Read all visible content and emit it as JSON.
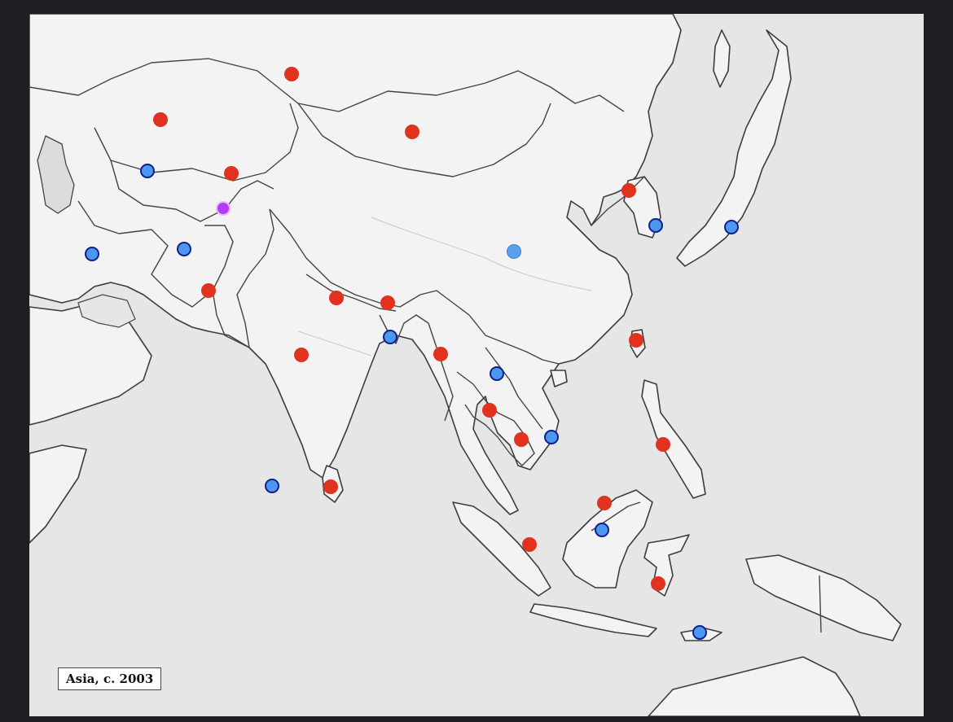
{
  "map": {
    "label": "Asia, c. 2003",
    "colors": {
      "sea": "#e6e6e6",
      "land": "#f3f3f3",
      "red_marker": "#e0321f",
      "blue_marker": "#4c97f0",
      "purple_marker": "#b13cf5"
    },
    "markers": [
      {
        "id": "marker-1",
        "color": "red"
      },
      {
        "id": "marker-2",
        "color": "red"
      },
      {
        "id": "marker-3",
        "color": "red"
      },
      {
        "id": "marker-4",
        "color": "blue"
      },
      {
        "id": "marker-5",
        "color": "red"
      },
      {
        "id": "marker-6",
        "color": "purple"
      },
      {
        "id": "marker-7",
        "color": "red"
      },
      {
        "id": "marker-8",
        "color": "blue"
      },
      {
        "id": "marker-9",
        "color": "blue"
      },
      {
        "id": "marker-10",
        "color": "blue"
      },
      {
        "id": "marker-11",
        "color": "light-blue"
      },
      {
        "id": "marker-12",
        "color": "red"
      },
      {
        "id": "marker-13",
        "color": "red"
      },
      {
        "id": "marker-14",
        "color": "red"
      },
      {
        "id": "marker-15",
        "color": "blue"
      },
      {
        "id": "marker-16",
        "color": "red"
      },
      {
        "id": "marker-17",
        "color": "red"
      },
      {
        "id": "marker-18",
        "color": "red"
      },
      {
        "id": "marker-19",
        "color": "blue"
      },
      {
        "id": "marker-20",
        "color": "red"
      },
      {
        "id": "marker-21",
        "color": "red"
      },
      {
        "id": "marker-22",
        "color": "blue"
      },
      {
        "id": "marker-23",
        "color": "red"
      },
      {
        "id": "marker-24",
        "color": "blue"
      },
      {
        "id": "marker-25",
        "color": "red"
      },
      {
        "id": "marker-26",
        "color": "red"
      },
      {
        "id": "marker-27",
        "color": "blue"
      },
      {
        "id": "marker-28",
        "color": "red"
      },
      {
        "id": "marker-29",
        "color": "red"
      },
      {
        "id": "marker-30",
        "color": "blue"
      },
      {
        "id": "marker-31",
        "color": "blue"
      }
    ]
  }
}
